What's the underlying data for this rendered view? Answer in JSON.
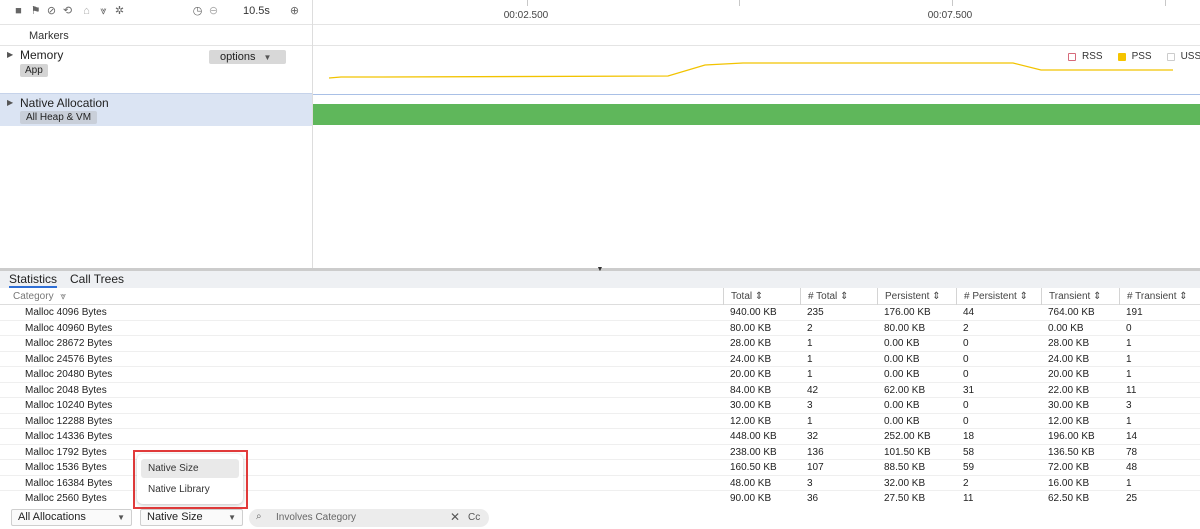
{
  "toolbar": {
    "icons": [
      "stop-icon",
      "flag-icon",
      "record-icon",
      "capture-icon",
      "save-icon",
      "filter-icon",
      "settings-icon"
    ],
    "duration": "10.5s",
    "timeline_ticks": [
      "00:02.500",
      "00:07.500"
    ]
  },
  "markers": {
    "label": "Markers"
  },
  "memory": {
    "title": "Memory",
    "chip": "App",
    "options_label": "options",
    "legend": [
      {
        "name": "RSS",
        "color": "#ffffff",
        "border": "#d66a7a"
      },
      {
        "name": "PSS",
        "color": "#f5c400",
        "border": "#f5c400"
      },
      {
        "name": "USS",
        "color": "#ffffff",
        "border": "#bbbbbb"
      }
    ],
    "line_color": "#f2c300"
  },
  "native": {
    "title": "Native Allocation",
    "chip": "All Heap & VM",
    "bar_color": "#5fb75b"
  },
  "tabs": [
    "Statistics",
    "Call Trees"
  ],
  "table": {
    "headers": [
      "Category",
      "Total",
      "# Total",
      "Persistent",
      "# Persistent",
      "Transient",
      "# Transient"
    ],
    "rows": [
      [
        "Malloc 4096 Bytes",
        "940.00 KB",
        "235",
        "176.00 KB",
        "44",
        "764.00 KB",
        "191"
      ],
      [
        "Malloc 40960 Bytes",
        "80.00 KB",
        "2",
        "80.00 KB",
        "2",
        "0.00 KB",
        "0"
      ],
      [
        "Malloc 28672 Bytes",
        "28.00 KB",
        "1",
        "0.00 KB",
        "0",
        "28.00 KB",
        "1"
      ],
      [
        "Malloc 24576 Bytes",
        "24.00 KB",
        "1",
        "0.00 KB",
        "0",
        "24.00 KB",
        "1"
      ],
      [
        "Malloc 20480 Bytes",
        "20.00 KB",
        "1",
        "0.00 KB",
        "0",
        "20.00 KB",
        "1"
      ],
      [
        "Malloc 2048 Bytes",
        "84.00 KB",
        "42",
        "62.00 KB",
        "31",
        "22.00 KB",
        "11"
      ],
      [
        "Malloc 10240 Bytes",
        "30.00 KB",
        "3",
        "0.00 KB",
        "0",
        "30.00 KB",
        "3"
      ],
      [
        "Malloc 12288 Bytes",
        "12.00 KB",
        "1",
        "0.00 KB",
        "0",
        "12.00 KB",
        "1"
      ],
      [
        "Malloc 14336 Bytes",
        "448.00 KB",
        "32",
        "252.00 KB",
        "18",
        "196.00 KB",
        "14"
      ],
      [
        "Malloc 1792 Bytes",
        "238.00 KB",
        "136",
        "101.50 KB",
        "58",
        "136.50 KB",
        "78"
      ],
      [
        "Malloc 1536 Bytes",
        "160.50 KB",
        "107",
        "88.50 KB",
        "59",
        "72.00 KB",
        "48"
      ],
      [
        "Malloc 16384 Bytes",
        "48.00 KB",
        "3",
        "32.00 KB",
        "2",
        "16.00 KB",
        "1"
      ],
      [
        "Malloc 2560 Bytes",
        "90.00 KB",
        "36",
        "27.50 KB",
        "11",
        "62.50 KB",
        "25"
      ]
    ]
  },
  "bottom": {
    "allocations_select": "All Allocations",
    "grouping_select": "Native Size",
    "search_placeholder": "Involves Category",
    "case_toggle": "Cc"
  },
  "dropdown": {
    "options": [
      "Native Size",
      "Native Library"
    ],
    "highlighted": "Native Size"
  }
}
